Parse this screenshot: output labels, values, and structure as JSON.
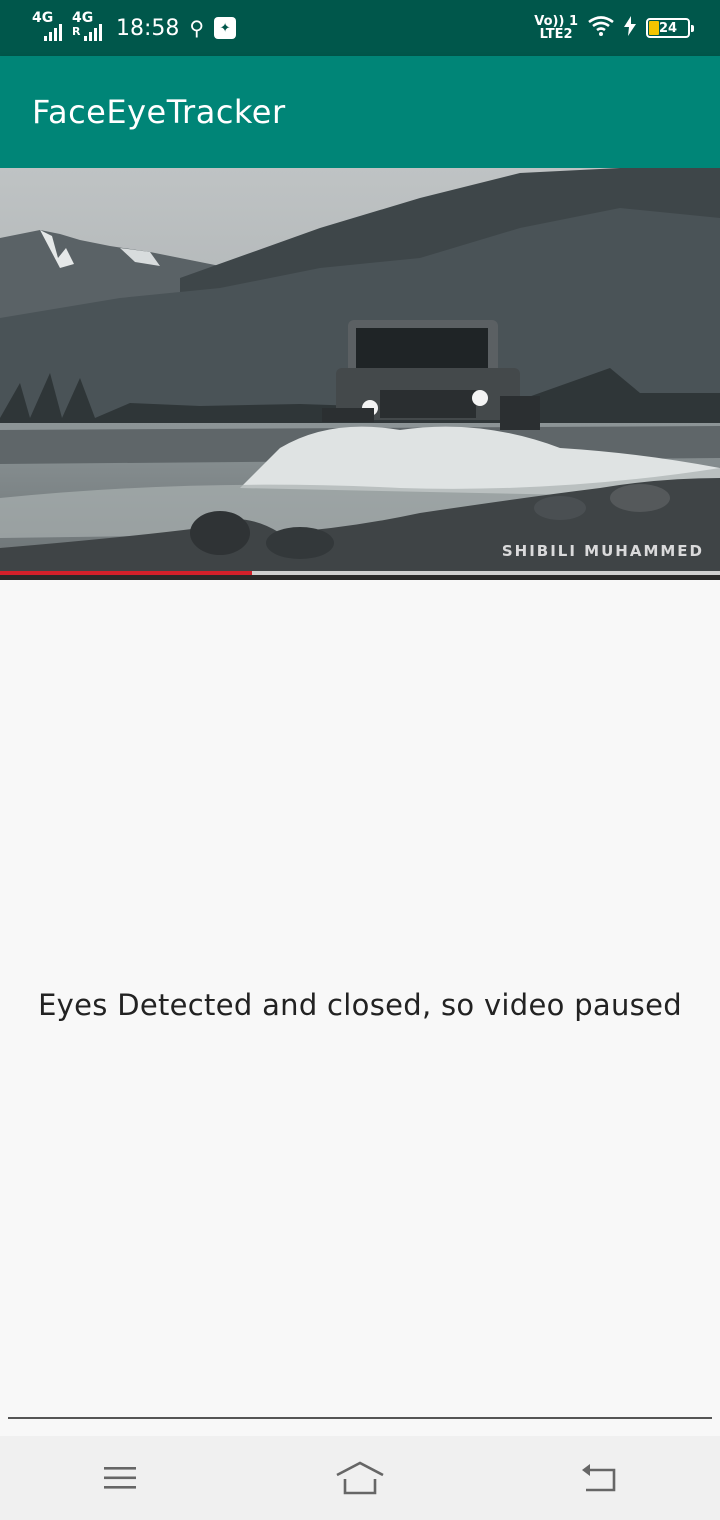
{
  "status_bar": {
    "network1": "4G",
    "network2": "4G",
    "network2_roaming": "R",
    "time": "18:58",
    "volte_top": "Vo)) 1",
    "volte_bottom": "LTE2",
    "battery_percent": "24",
    "battery_level": 0.24,
    "icons": [
      "signal-icon",
      "usb-icon",
      "app-notification-icon",
      "wifi-icon",
      "charging-icon",
      "battery-icon"
    ]
  },
  "app_bar": {
    "title": "FaceEyeTracker"
  },
  "video": {
    "watermark": "SHIBILI MUHAMMED",
    "played_fraction": 0.35,
    "buffered_fraction": 1.0,
    "colors": {
      "played": "#d2202a",
      "buffer": "#cfcfcf"
    }
  },
  "main": {
    "status_message": "Eyes Detected and closed, so video paused"
  },
  "nav_bar": {
    "icons": [
      "menu-icon",
      "home-icon",
      "back-icon"
    ]
  },
  "colors": {
    "status_bar": "#00574b",
    "app_bar": "#008577",
    "background": "#f8f8f8"
  }
}
